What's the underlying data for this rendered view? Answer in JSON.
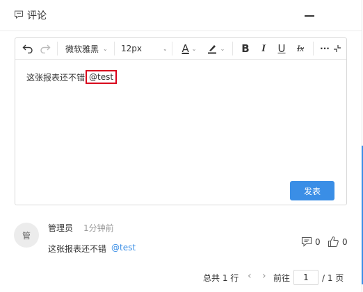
{
  "header": {
    "title": "评论",
    "title_icon": "comment-icon",
    "minimize_icon": "minimize-icon"
  },
  "toolbar": {
    "undo_icon": "undo-icon",
    "redo_icon": "redo-icon",
    "font_family": "微软雅黑",
    "font_size": "12px",
    "font_color_label": "A",
    "bold_label": "B",
    "italic_label": "I",
    "underline_label": "U",
    "clear_format_label": "Ix",
    "more_label": "···"
  },
  "editor": {
    "text": "这张报表还不错",
    "mention": "@test",
    "submit_label": "发表"
  },
  "comment": {
    "avatar_text": "管",
    "author": "管理员",
    "time": "1分钟前",
    "text": "这张报表还不错",
    "mention": "@test",
    "reply_count": "0",
    "like_count": "0"
  },
  "pagination": {
    "total": "总共 1 行",
    "goto_label": "前往",
    "current_page": "1",
    "pages_label": "/ 1 页"
  },
  "colors": {
    "accent": "#3a8ee6",
    "mention_border": "#d9001b"
  }
}
